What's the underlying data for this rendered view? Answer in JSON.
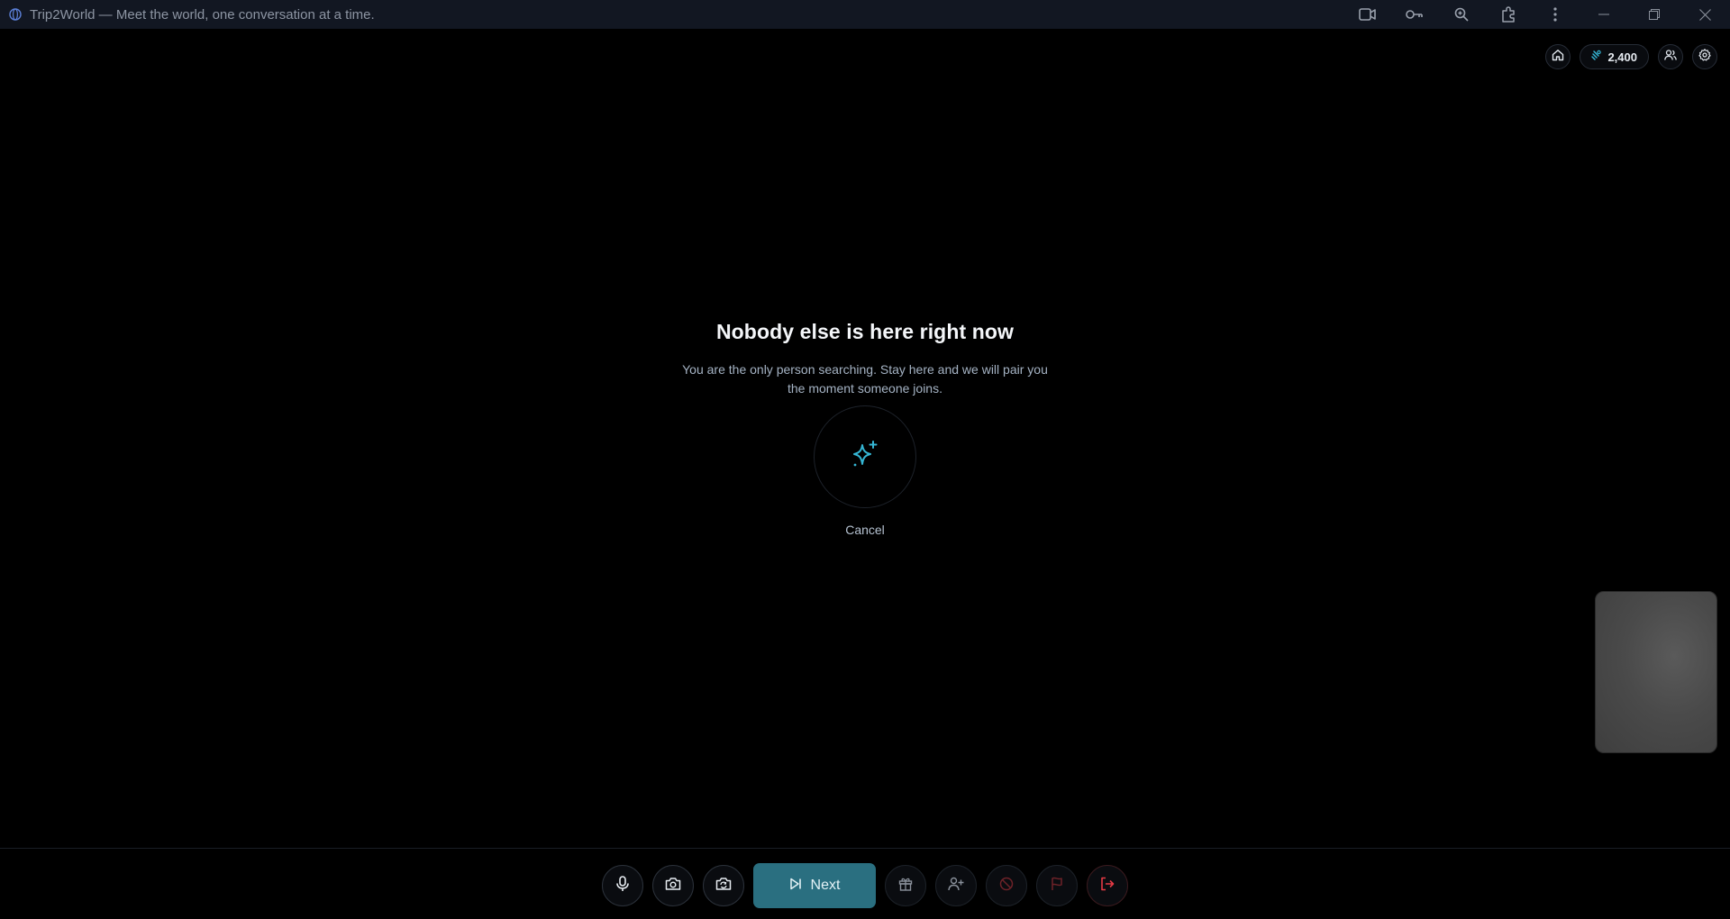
{
  "window": {
    "title": "Trip2World — Meet the world, one conversation at a time."
  },
  "top_bar": {
    "credits": "2,400"
  },
  "status": {
    "headline": "Nobody else is here right now",
    "message": "You are the only person searching. Stay here and we will pair you the moment someone joins.",
    "cancel_label": "Cancel"
  },
  "controls": {
    "next_label": "Next"
  },
  "colors": {
    "accent": "#2a6f80",
    "spark": "#35b6d4",
    "danger": "#e53a45",
    "background": "#000000"
  },
  "icons": [
    "globe-icon",
    "video-icon",
    "key-icon",
    "zoom-icon",
    "extensions-icon",
    "more-icon",
    "minimize-icon",
    "restore-icon",
    "close-icon",
    "home-icon",
    "credits-icon",
    "friends-icon",
    "settings-icon",
    "sparkles-icon",
    "microphone-icon",
    "camera-icon",
    "switch-camera-icon",
    "skip-icon",
    "gift-icon",
    "add-friend-icon",
    "block-icon",
    "report-flag-icon",
    "leave-icon"
  ]
}
